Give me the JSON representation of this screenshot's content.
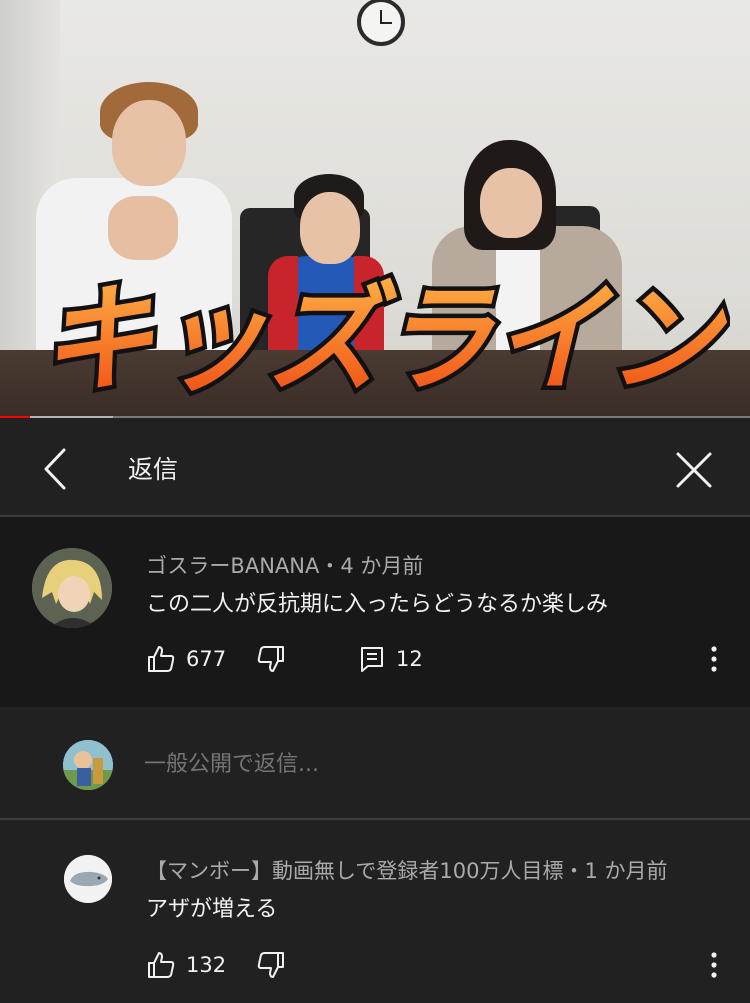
{
  "video": {
    "title_overlay": "キッズライン",
    "progress": 0.04,
    "buffered": 0.15,
    "colors": {
      "progress": "#ff0000",
      "overlay_fill": "#f26a1b",
      "overlay_stroke": "#111111"
    }
  },
  "panel": {
    "title": "返信",
    "back_icon": "chevron-left-icon",
    "close_icon": "close-icon"
  },
  "parent_comment": {
    "meta": "ゴスラーBANANA・4 か月前",
    "text": "この二人が反抗期に入ったらどうなるか楽しみ",
    "likes": "677",
    "replies": "12"
  },
  "reply_box": {
    "placeholder": "一般公開で返信..."
  },
  "reply_comment": {
    "meta": "【マンボー】動画無しで登録者100万人目標・1 か月前",
    "text": "アザが増える",
    "likes": "132"
  }
}
